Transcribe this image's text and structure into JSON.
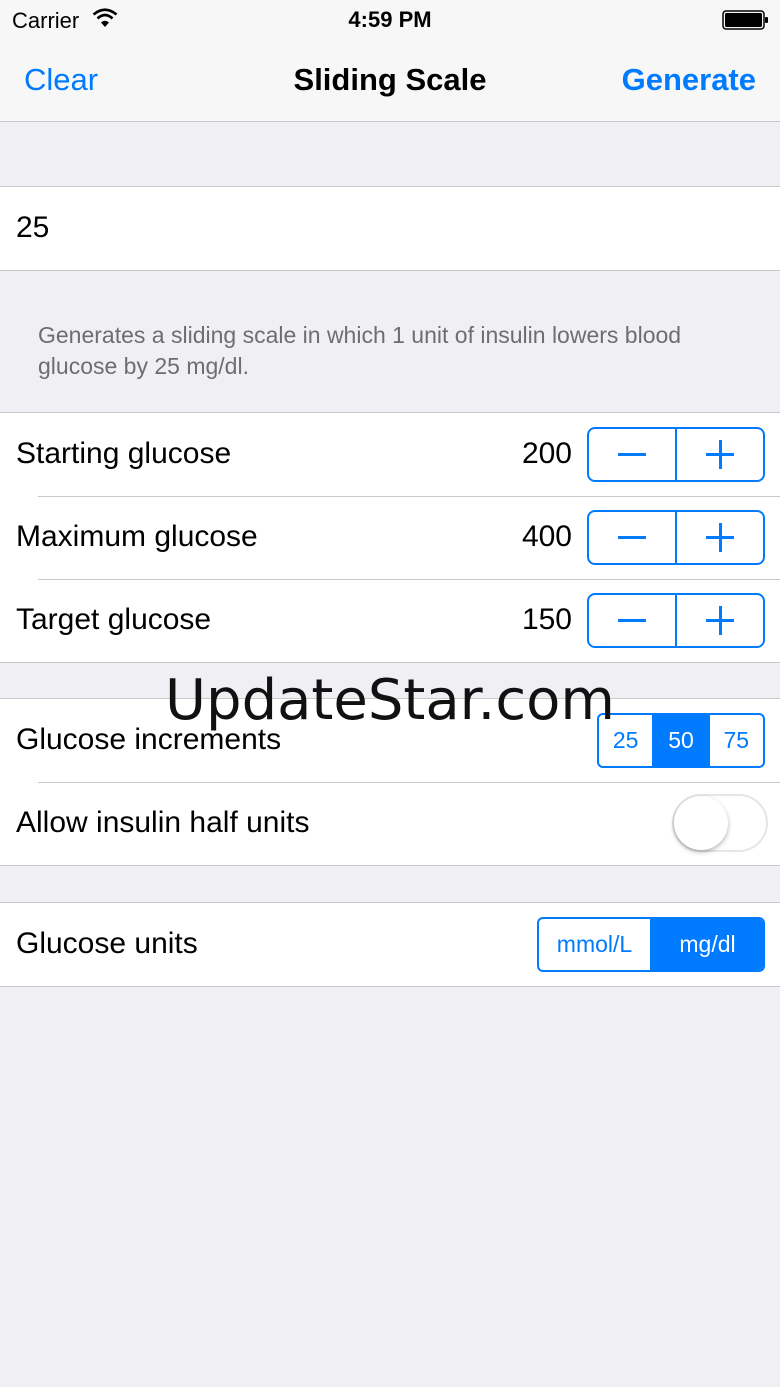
{
  "status_bar": {
    "carrier": "Carrier",
    "time": "4:59 PM",
    "wifi_icon": "wifi-icon",
    "battery_icon": "battery-icon"
  },
  "nav": {
    "left_button": "Clear",
    "title": "Sliding Scale",
    "right_button": "Generate"
  },
  "correction_factor": {
    "value": "25",
    "footer": "Generates a sliding scale in which 1 unit of insulin lowers blood glucose by 25 mg/dl."
  },
  "glucose_settings": [
    {
      "label": "Starting glucose",
      "value": "200"
    },
    {
      "label": "Maximum glucose",
      "value": "400"
    },
    {
      "label": "Target glucose",
      "value": "150"
    }
  ],
  "increments": {
    "label": "Glucose increments",
    "options": [
      "25",
      "50",
      "75"
    ],
    "selected": "50"
  },
  "half_units": {
    "label": "Allow insulin half units",
    "enabled": false
  },
  "units": {
    "label": "Glucose units",
    "options": [
      "mmol/L",
      "mg/dl"
    ],
    "selected": "mg/dl"
  },
  "watermark": "UpdateStar.com",
  "colors": {
    "accent": "#007aff",
    "background": "#efeff4",
    "separator": "#c8c7cc",
    "footer_text": "#6d6d72"
  }
}
